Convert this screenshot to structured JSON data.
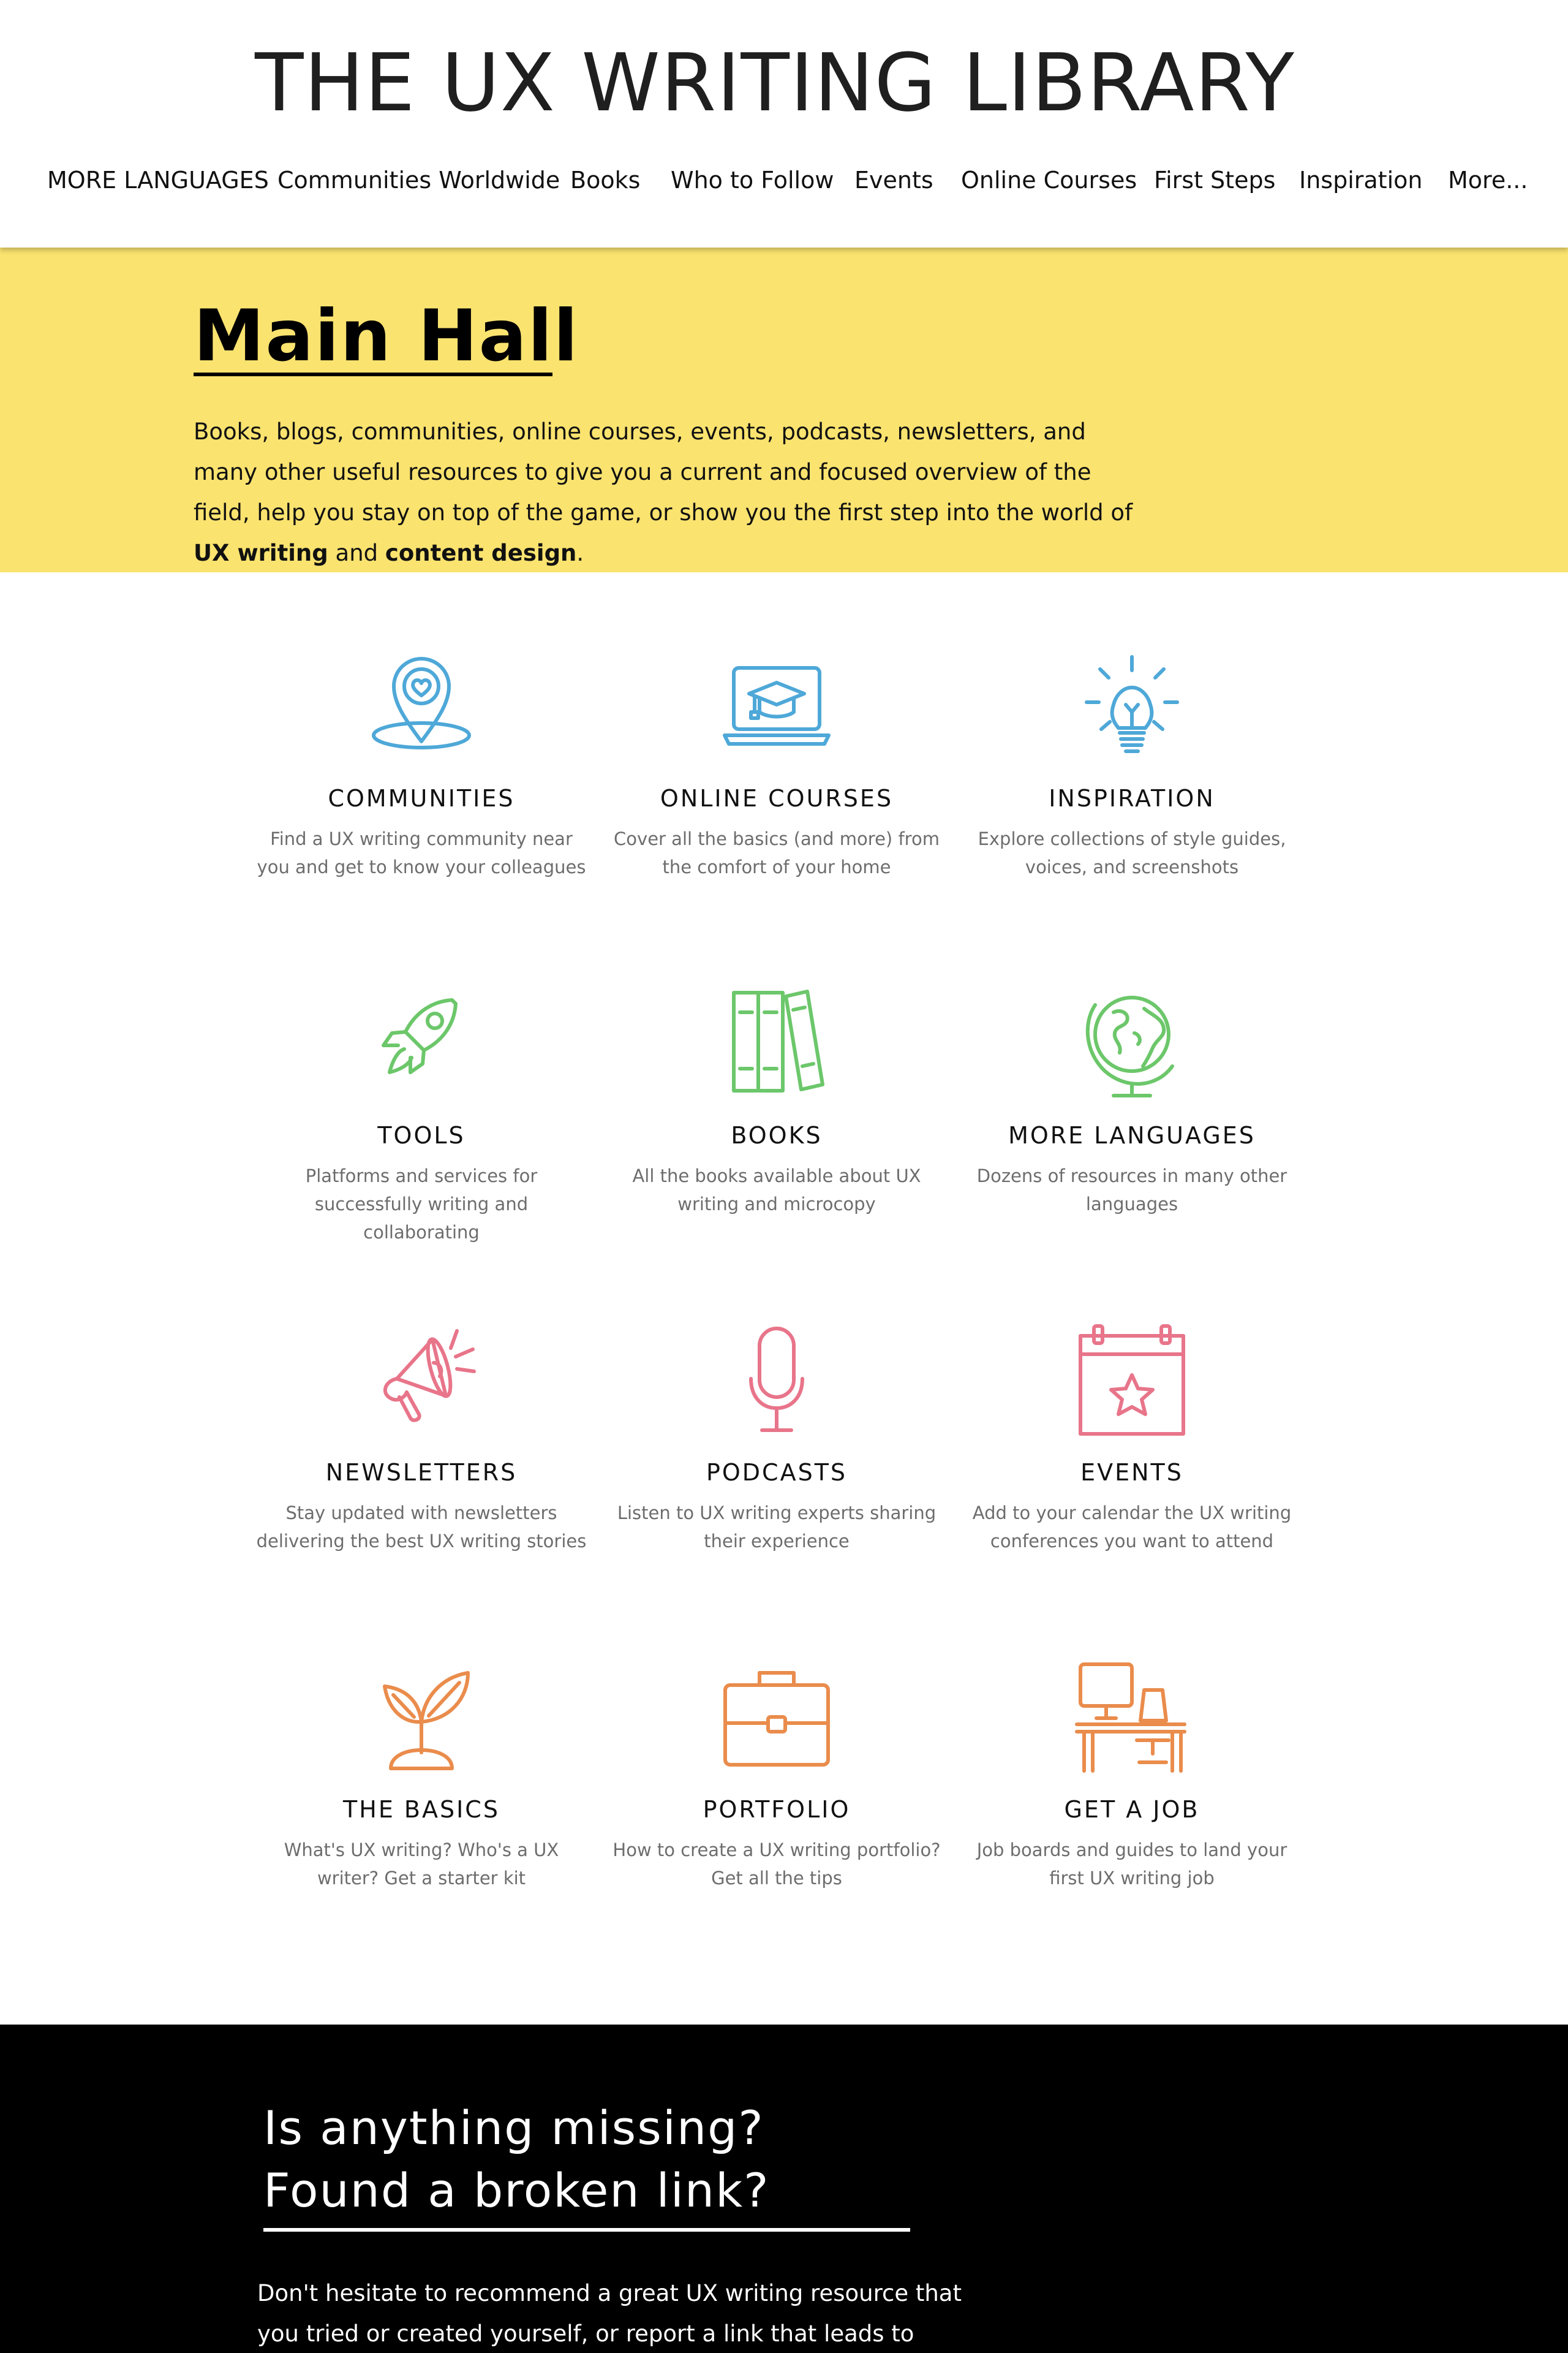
{
  "header": {
    "site_title": "THE UX WRITING LIBRARY",
    "nav": [
      {
        "label": "MORE LANGUAGES"
      },
      {
        "label": "Communities Worldwide"
      },
      {
        "label": "Books"
      },
      {
        "label": "Who to Follow"
      },
      {
        "label": "Events"
      },
      {
        "label": "Online Courses"
      },
      {
        "label": "First Steps"
      },
      {
        "label": "Inspiration"
      },
      {
        "label": "More..."
      }
    ]
  },
  "hero": {
    "title": "Main Hall",
    "text_1": "Books, blogs, communities, online courses, events, podcasts, newsletters, and many other useful resources to give you a current and focused overview of the field, help you stay on top of the game, or show you the first step into the world of ",
    "link_1": "UX writing",
    "text_2": " and ",
    "link_2": "content design",
    "text_3": ".",
    "background_color": "#fae36f"
  },
  "cards": [
    {
      "title": "COMMUNITIES",
      "desc": "Find a UX writing community near you and get to know your colleagues",
      "icon": "map-pin-heart-icon",
      "color": "#4ea8d8"
    },
    {
      "title": "ONLINE COURSES",
      "desc": "Cover all the basics (and more) from the comfort of your home",
      "icon": "laptop-graduation-cap-icon",
      "color": "#4ea8d8"
    },
    {
      "title": "INSPIRATION",
      "desc": "Explore collections of style guides, voices, and screenshots",
      "icon": "lightbulb-icon",
      "color": "#4ea8d8"
    },
    {
      "title": "TOOLS",
      "desc": "Platforms and services for successfully writing and collaborating",
      "icon": "rocket-icon",
      "color": "#6cc76a"
    },
    {
      "title": "BOOKS",
      "desc": "All the books available about UX writing and microcopy",
      "icon": "books-icon",
      "color": "#6cc76a"
    },
    {
      "title": "MORE LANGUAGES",
      "desc": "Dozens of resources in many other languages",
      "icon": "globe-icon",
      "color": "#6cc76a"
    },
    {
      "title": "NEWSLETTERS",
      "desc": "Stay updated with newsletters delivering the best UX writing stories",
      "icon": "megaphone-icon",
      "color": "#e8758a"
    },
    {
      "title": "PODCASTS",
      "desc": "Listen to UX writing experts sharing their experience",
      "icon": "microphone-icon",
      "color": "#e8758a"
    },
    {
      "title": "EVENTS",
      "desc": "Add to your calendar the UX writing conferences you want to attend",
      "icon": "calendar-star-icon",
      "color": "#e8758a"
    },
    {
      "title": "THE BASICS",
      "desc": "What's UX writing? Who's a UX writer? Get a starter kit",
      "icon": "sprout-icon",
      "color": "#ea8c4c"
    },
    {
      "title": "PORTFOLIO",
      "desc": "How to create a UX writing portfolio? Get all the tips",
      "icon": "briefcase-icon",
      "color": "#ea8c4c"
    },
    {
      "title": "GET A JOB",
      "desc": "Job boards and guides to land your first UX writing job",
      "icon": "desk-icon",
      "color": "#ea8c4c"
    }
  ],
  "footer": {
    "title_line_1": "Is anything missing?",
    "title_line_2": "Found a broken link?",
    "text": "Don't hesitate to recommend a great UX writing resource that you tried or created yourself, or report a link that leads to Narnia"
  }
}
